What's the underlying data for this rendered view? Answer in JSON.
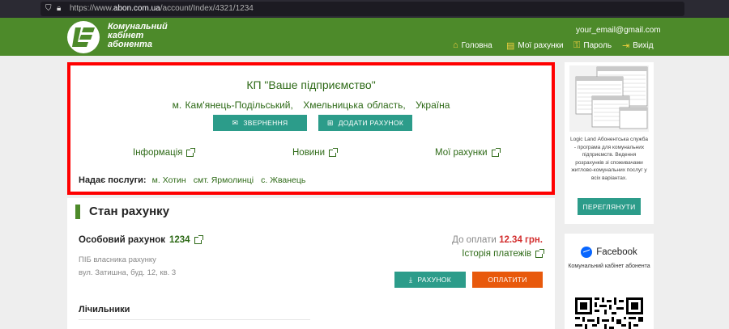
{
  "browser": {
    "url_prefix": "https://www.",
    "url_domain": "abon.com.ua",
    "url_path": "/account/Index/4321/1234"
  },
  "header": {
    "logo_lines": [
      "Комунальний",
      "кабінет",
      "абонента"
    ],
    "email": "your_email@gmail.com",
    "nav": {
      "home": "Головна",
      "accounts": "Мої рахунки",
      "password": "Пароль",
      "logout": "Вихід"
    }
  },
  "company": {
    "name": "КП \"Ваше підприємство\"",
    "city": "м. Кам'янець-Подільський,",
    "region": "Хмельницька область,",
    "country": "Україна",
    "appeal_button": "ЗВЕРНЕННЯ",
    "add_account_button": "ДОДАТИ РАХУНОК",
    "links": {
      "info": "Інформація",
      "news": "Новини",
      "my_accounts": "Мої рахунки"
    },
    "services_label": "Надає послуги:",
    "services": [
      "м. Хотин",
      "смт. Ярмолинці",
      "с. Жванець"
    ]
  },
  "account": {
    "section_title": "Стан рахунку",
    "label": "Особовий рахунок",
    "number": "1234",
    "owner_placeholder": "ПІБ власника рахунку",
    "address": "вул. Затишна, буд. 12, кв. 3",
    "due_label": "До оплати",
    "due_amount": "12.34 грн.",
    "history_link": "Історія платежів",
    "invoice_button": "РАХУНОК",
    "pay_button": "ОПЛАТИТИ",
    "meters_title": "Лічильники"
  },
  "sidebar": {
    "ad_text": "Logic Land Абонентська служба - програма для комунальних підприємств. Ведення розрахунків зі споживачами житлово-комунальних послуг у всіх варіантах.",
    "view_button": "ПЕРЕГЛЯНУТИ",
    "fb_title": "Facebook",
    "fb_text": "Комунальний кабінет абонента"
  },
  "colors": {
    "header_green": "#4d8a2a",
    "link_green": "#2e6a17",
    "teal_button": "#2c9c8a",
    "orange_button": "#e8590c",
    "highlight_border": "#ff0000",
    "due_red": "#d32f2f"
  }
}
